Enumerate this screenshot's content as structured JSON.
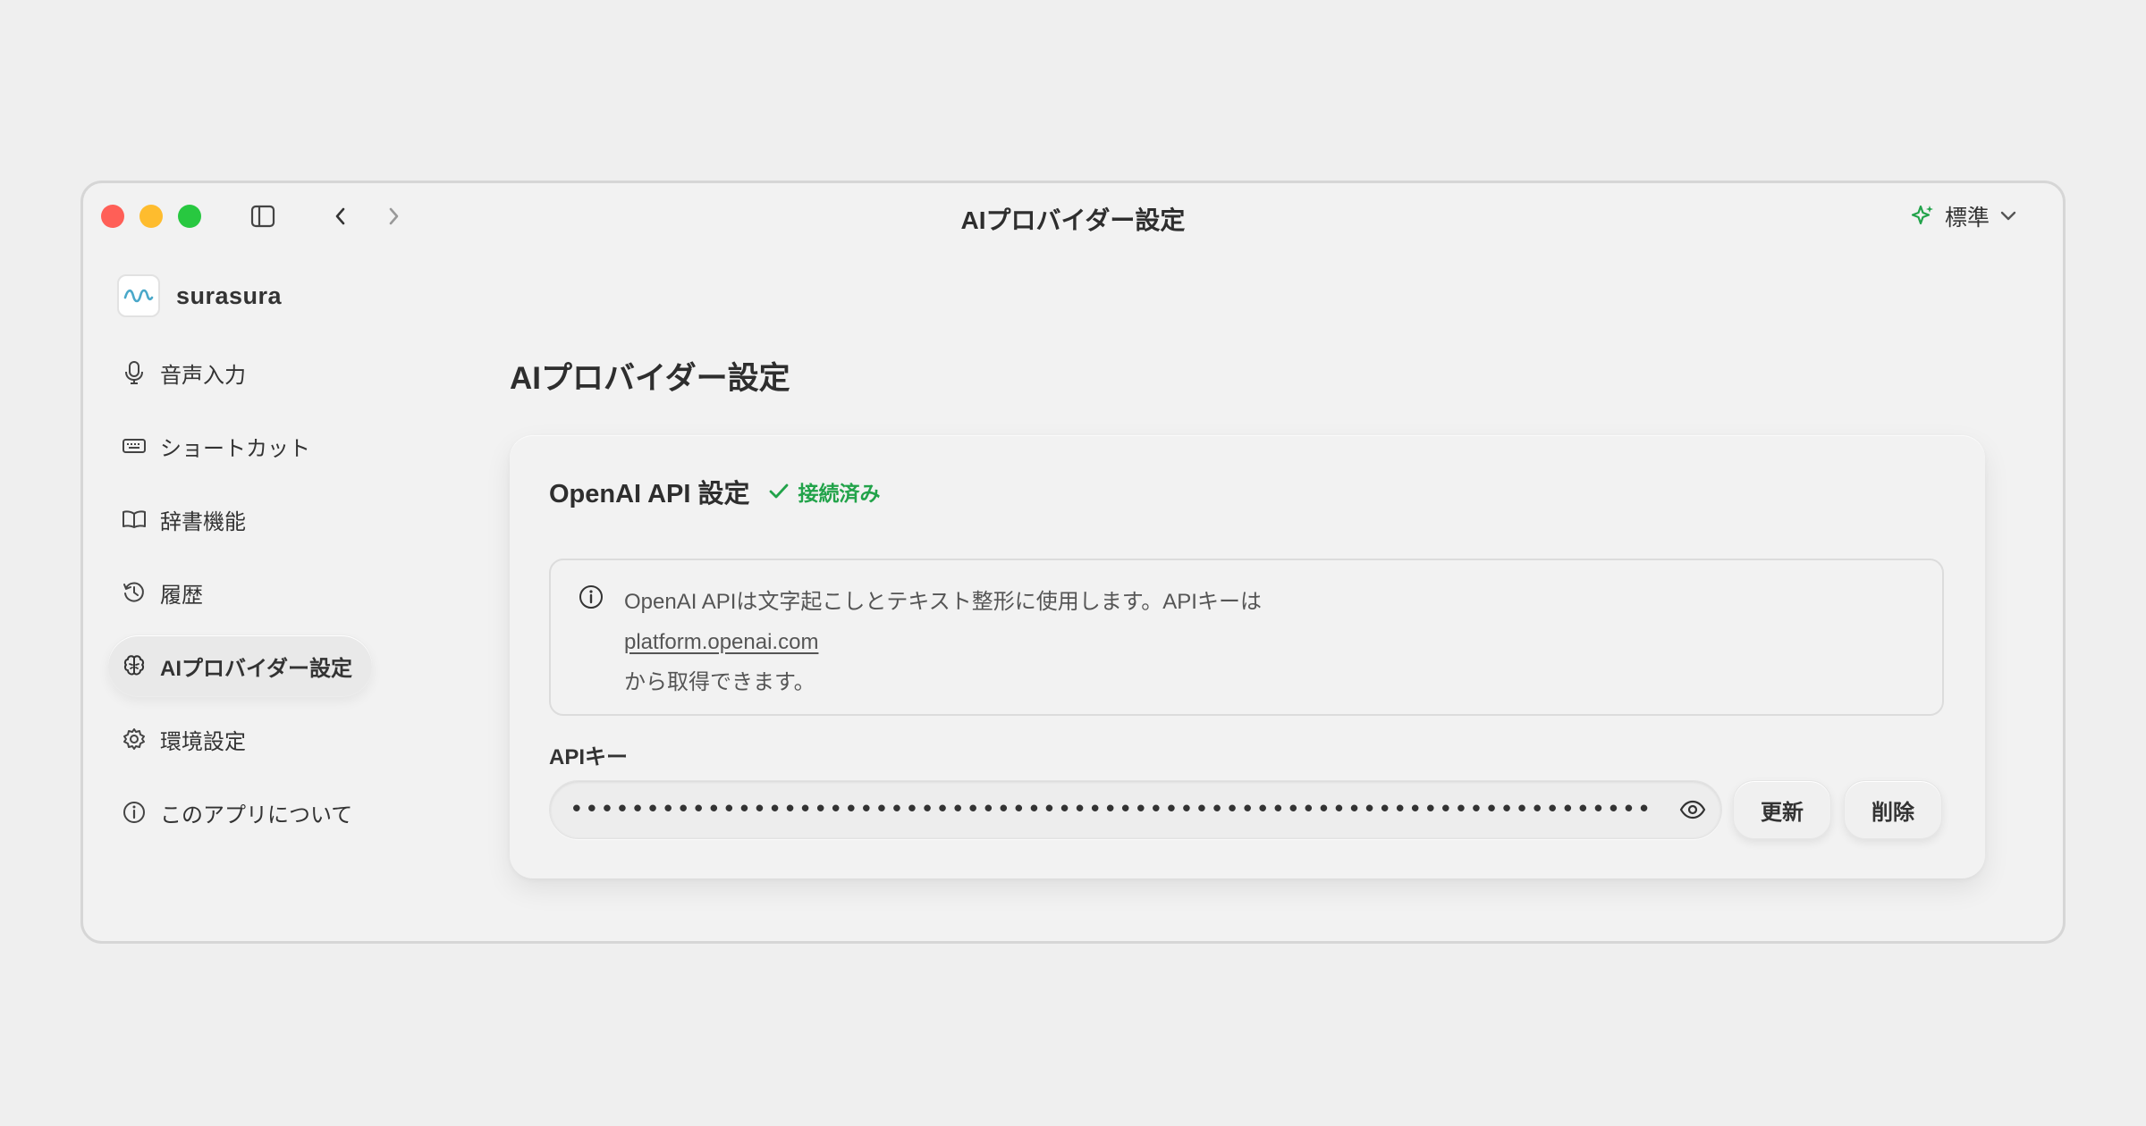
{
  "window": {
    "title": "AIプロバイダー設定",
    "mode_label": "標準"
  },
  "sidebar": {
    "brand": "surasura",
    "items": [
      {
        "label": "音声入力",
        "icon": "microphone-icon"
      },
      {
        "label": "ショートカット",
        "icon": "keyboard-icon"
      },
      {
        "label": "辞書機能",
        "icon": "book-icon"
      },
      {
        "label": "履歴",
        "icon": "history-icon"
      },
      {
        "label": "AIプロバイダー設定",
        "icon": "brain-icon",
        "active": true
      },
      {
        "label": "環境設定",
        "icon": "gear-icon"
      },
      {
        "label": "このアプリについて",
        "icon": "info-icon"
      }
    ]
  },
  "main": {
    "page_title": "AIプロバイダー設定",
    "card": {
      "title": "OpenAI API 設定",
      "status": "接続済み",
      "info_line1": "OpenAI APIは文字起こしとテキスト整形に使用します。APIキーは",
      "info_link": "platform.openai.com",
      "info_line3": "から取得できます。",
      "field_label": "APIキー",
      "key_masked": "••••••••••••••••••••••••••••••••••••••••••••••••••••••••••••••••••••••••••••••••••••••••••••••••••••••••••••••",
      "update_label": "更新",
      "delete_label": "削除"
    }
  },
  "colors": {
    "accent_green": "#22a34a",
    "brand_wave": "#4aa8c9"
  }
}
